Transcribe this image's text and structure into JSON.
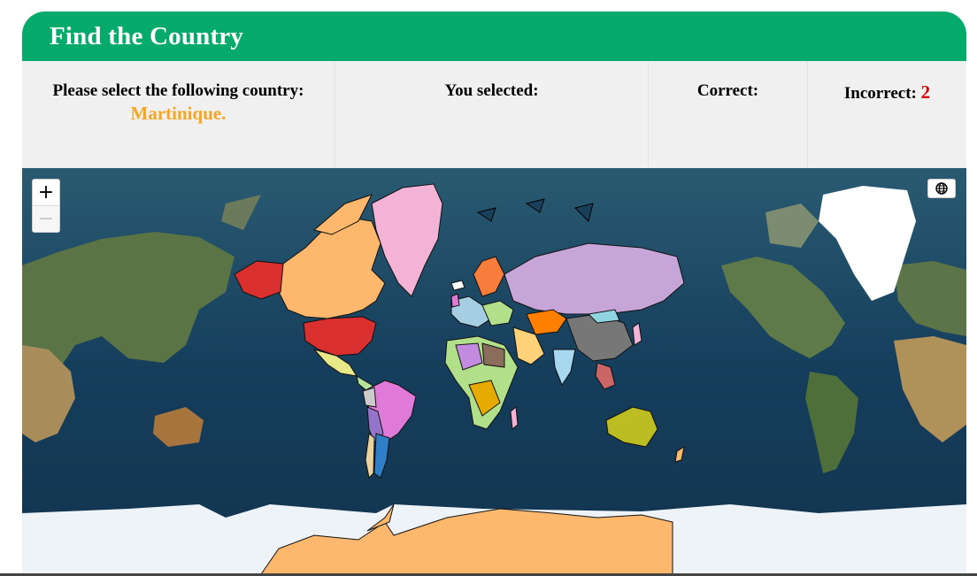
{
  "header": {
    "title": "Find the Country"
  },
  "prompt": {
    "label": "Please select the following country:",
    "country": "Martinique."
  },
  "selected": {
    "label": "You selected:"
  },
  "correct": {
    "label": "Correct:"
  },
  "incorrect": {
    "label": "Incorrect:",
    "value": "2"
  },
  "map": {
    "zoom_in": "+",
    "zoom_out": "−",
    "layer_icon": "globe-icon"
  }
}
